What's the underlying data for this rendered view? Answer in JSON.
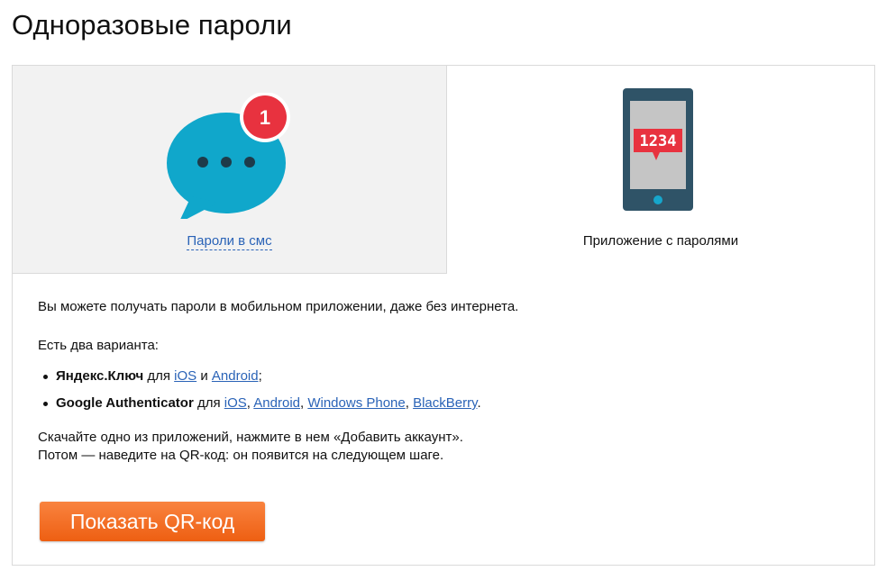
{
  "page": {
    "title": "Одноразовые пароли"
  },
  "tabs": {
    "sms": {
      "label": "Пароли в смс",
      "badge": "1",
      "icon": "chat-bubble-icon"
    },
    "app": {
      "label": "Приложение с паролями",
      "code": "1234",
      "icon": "phone-icon"
    }
  },
  "content": {
    "intro": "Вы можете получать пароли в мобильном приложении, даже без интернета.",
    "variants": "Есть два варианта:",
    "apps": [
      {
        "name": "Яндекс.Ключ",
        "for": "для",
        "platforms": [
          "iOS",
          "Android"
        ],
        "and": "и",
        "end": ";"
      },
      {
        "name": "Google Authenticator",
        "for": "для",
        "platforms": [
          "iOS",
          "Android",
          "Windows Phone",
          "BlackBerry"
        ],
        "end": "."
      }
    ],
    "instructions_line1": "Скачайте одно из приложений, нажмите в нем «Добавить аккаунт».",
    "instructions_line2": "Потом — наведите на QR-код: он появится на следующем шаге."
  },
  "button": {
    "label": "Показать QR-код"
  },
  "colors": {
    "chat_bubble": "#10a7cb",
    "badge": "#e8323f",
    "phone_body": "#2f5367",
    "phone_screen": "#c5c5c5",
    "code_box": "#e8323f",
    "phone_button": "#16a6cc",
    "link": "#2a63b7",
    "button_top": "#f9833f",
    "button_bottom": "#ee5f12"
  }
}
